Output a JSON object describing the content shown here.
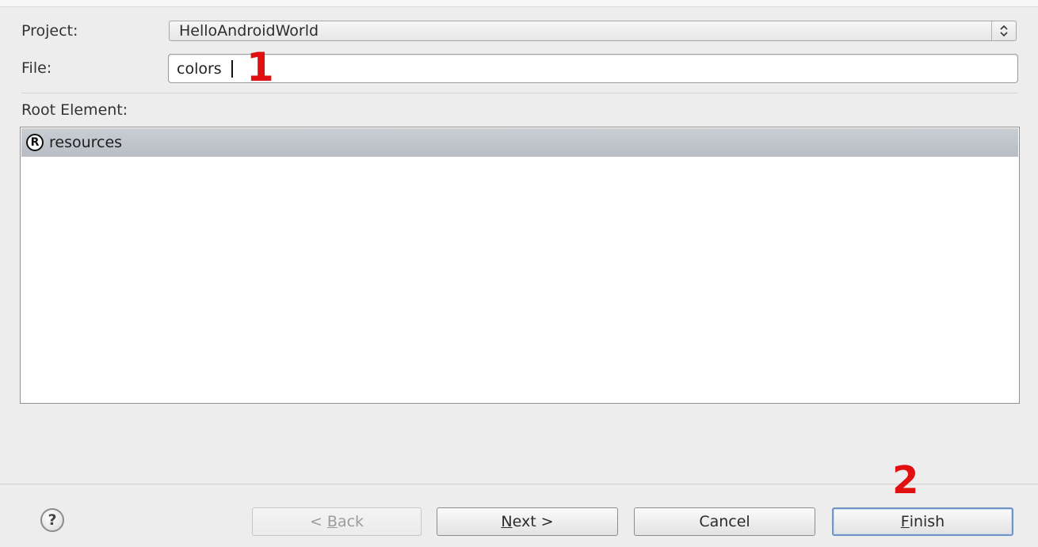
{
  "form": {
    "project_label": "Project:",
    "project_value": "HelloAndroidWorld",
    "file_label": "File:",
    "file_value": "colors",
    "root_label": "Root Element:"
  },
  "root_elements": [
    {
      "icon": "R",
      "label": "resources",
      "selected": true
    }
  ],
  "buttons": {
    "back": {
      "prefix": "< ",
      "mnemonic": "B",
      "rest": "ack",
      "enabled": false
    },
    "next": {
      "mnemonic": "N",
      "rest": "ext >",
      "enabled": true
    },
    "cancel": {
      "label": "Cancel",
      "enabled": true
    },
    "finish": {
      "mnemonic": "F",
      "rest": "inish",
      "enabled": true,
      "default": true
    }
  },
  "help": {
    "glyph": "?"
  },
  "annotations": {
    "step1": "1",
    "step2": "2",
    "color": "#e01010"
  },
  "colors": {
    "selection": "#bcc2c8",
    "default_button_border": "#6f95c5"
  }
}
